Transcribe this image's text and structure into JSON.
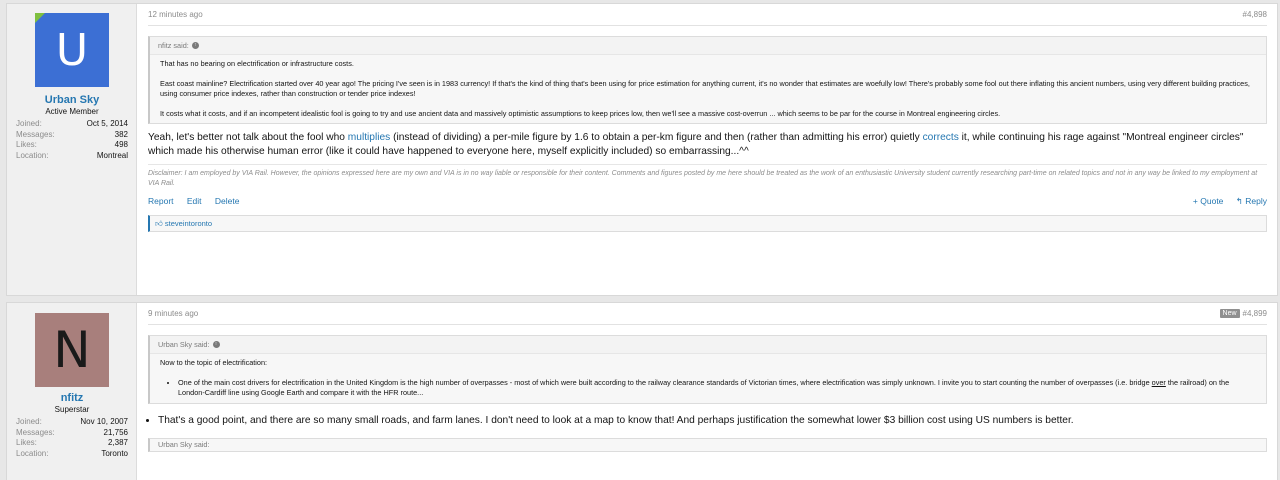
{
  "posts": [
    {
      "user": {
        "initial": "U",
        "name": "Urban Sky",
        "title": "Active Member",
        "stats": [
          {
            "label": "Joined:",
            "value": "Oct 5, 2014"
          },
          {
            "label": "Messages:",
            "value": "382"
          },
          {
            "label": "Likes:",
            "value": "498"
          },
          {
            "label": "Location:",
            "value": "Montreal"
          }
        ]
      },
      "time": "12 minutes ago",
      "number": "#4,898",
      "quote": {
        "author": "nfitz said:",
        "paragraphs": [
          "That has no bearing on electrification or infrastructure costs.",
          "East coast mainline? Electrification started over 40 year ago! The pricing I've seen is in 1983 currency! If that's the kind of thing that's been using for price estimation for anything current, it's no wonder that estimates are woefully low! There's probably some fool out there inflating this ancient numbers, using very different building practices, using consumer price indexes, rather than construction or tender price indexes!",
          "It costs what it costs, and if an incompetent idealistic fool is going to try and use ancient data and massively optimistic assumptions to keep prices low, then we'll see a massive cost-overrun ... which seems to be par for the course in Montreal engineering circles."
        ]
      },
      "message": {
        "part1": "Yeah, let's better not talk about the fool who ",
        "link1": "multiplies",
        "part2": " (instead of dividing) a per-mile figure by 1.6 to obtain a per-km figure and then (rather than admitting his error) quietly ",
        "link2": "corrects",
        "part3": " it, while continuing his rage against \"Montreal engineer circles\" which made his otherwise human error (like it could have happened to everyone here, myself explicitly included) so embarrassing...^^"
      },
      "signature": "Disclaimer: I am employed by VIA Rail. However, the opinions expressed here are my own and VIA is in no way liable or responsible for their content. Comments and figures posted by me here should be treated as the work of an enthusiastic University student currently researching part-time on related topics and not in any way be linked to my employment at VIA Rail.",
      "actions": {
        "report": "Report",
        "edit": "Edit",
        "delete": "Delete",
        "quote": "+ Quote",
        "reply": "↰ Reply"
      },
      "likes": "steveintoronto"
    },
    {
      "user": {
        "initial": "N",
        "name": "nfitz",
        "title": "Superstar",
        "stats": [
          {
            "label": "Joined:",
            "value": "Nov 10, 2007"
          },
          {
            "label": "Messages:",
            "value": "21,756"
          },
          {
            "label": "Likes:",
            "value": "2,387"
          },
          {
            "label": "Location:",
            "value": "Toronto"
          }
        ]
      },
      "time": "9 minutes ago",
      "badge": "New",
      "number": "#4,899",
      "quote": {
        "author": "Urban Sky said:",
        "intro": "Now to the topic of electrification:",
        "bullet_before": "One of the main cost drivers for electrification in the United Kingdom is the high number of overpasses - most of which were built according to the railway clearance standards of Victorian times, where electrification was simply unknown. I invite you to start counting the number of overpasses (i.e. bridge ",
        "bullet_underline": "over",
        "bullet_after": " the railroad) on the London-Cardiff line using Google Earth and compare it with the HFR route..."
      },
      "bullet": "That's a good point, and there are so many small roads, and farm lanes. I don't need to look at a map to know that! And perhaps justification the somewhat lower $3 billion cost using US numbers is better.",
      "next_quote": "Urban Sky said:"
    }
  ],
  "icons": {
    "quote_arrow": "arrow-up-icon",
    "like": "thumbs-up-icon"
  },
  "colors": {
    "link": "#2577b1",
    "avatar_u": "#3c6fd4",
    "avatar_n": "#a87f7c"
  }
}
